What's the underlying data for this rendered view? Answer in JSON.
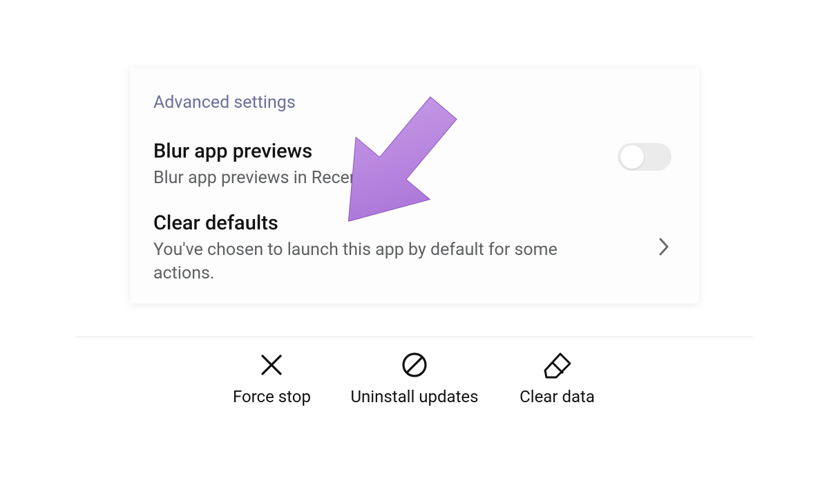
{
  "section": {
    "header": "Advanced settings"
  },
  "blur_previews": {
    "title": "Blur app previews",
    "subtitle_before": "Blur app previews in ",
    "subtitle_obscured": "Recen",
    "subtitle_after": "ts",
    "toggle_on": false
  },
  "clear_defaults": {
    "title": "Clear defaults",
    "subtitle": "You've chosen to launch this app by default for some actions."
  },
  "actions": {
    "force_stop": "Force stop",
    "uninstall_updates": "Uninstall updates",
    "clear_data": "Clear data"
  },
  "annotation": {
    "arrow_points_to": "clear-defaults-row",
    "arrow_color": "#b57edc"
  }
}
